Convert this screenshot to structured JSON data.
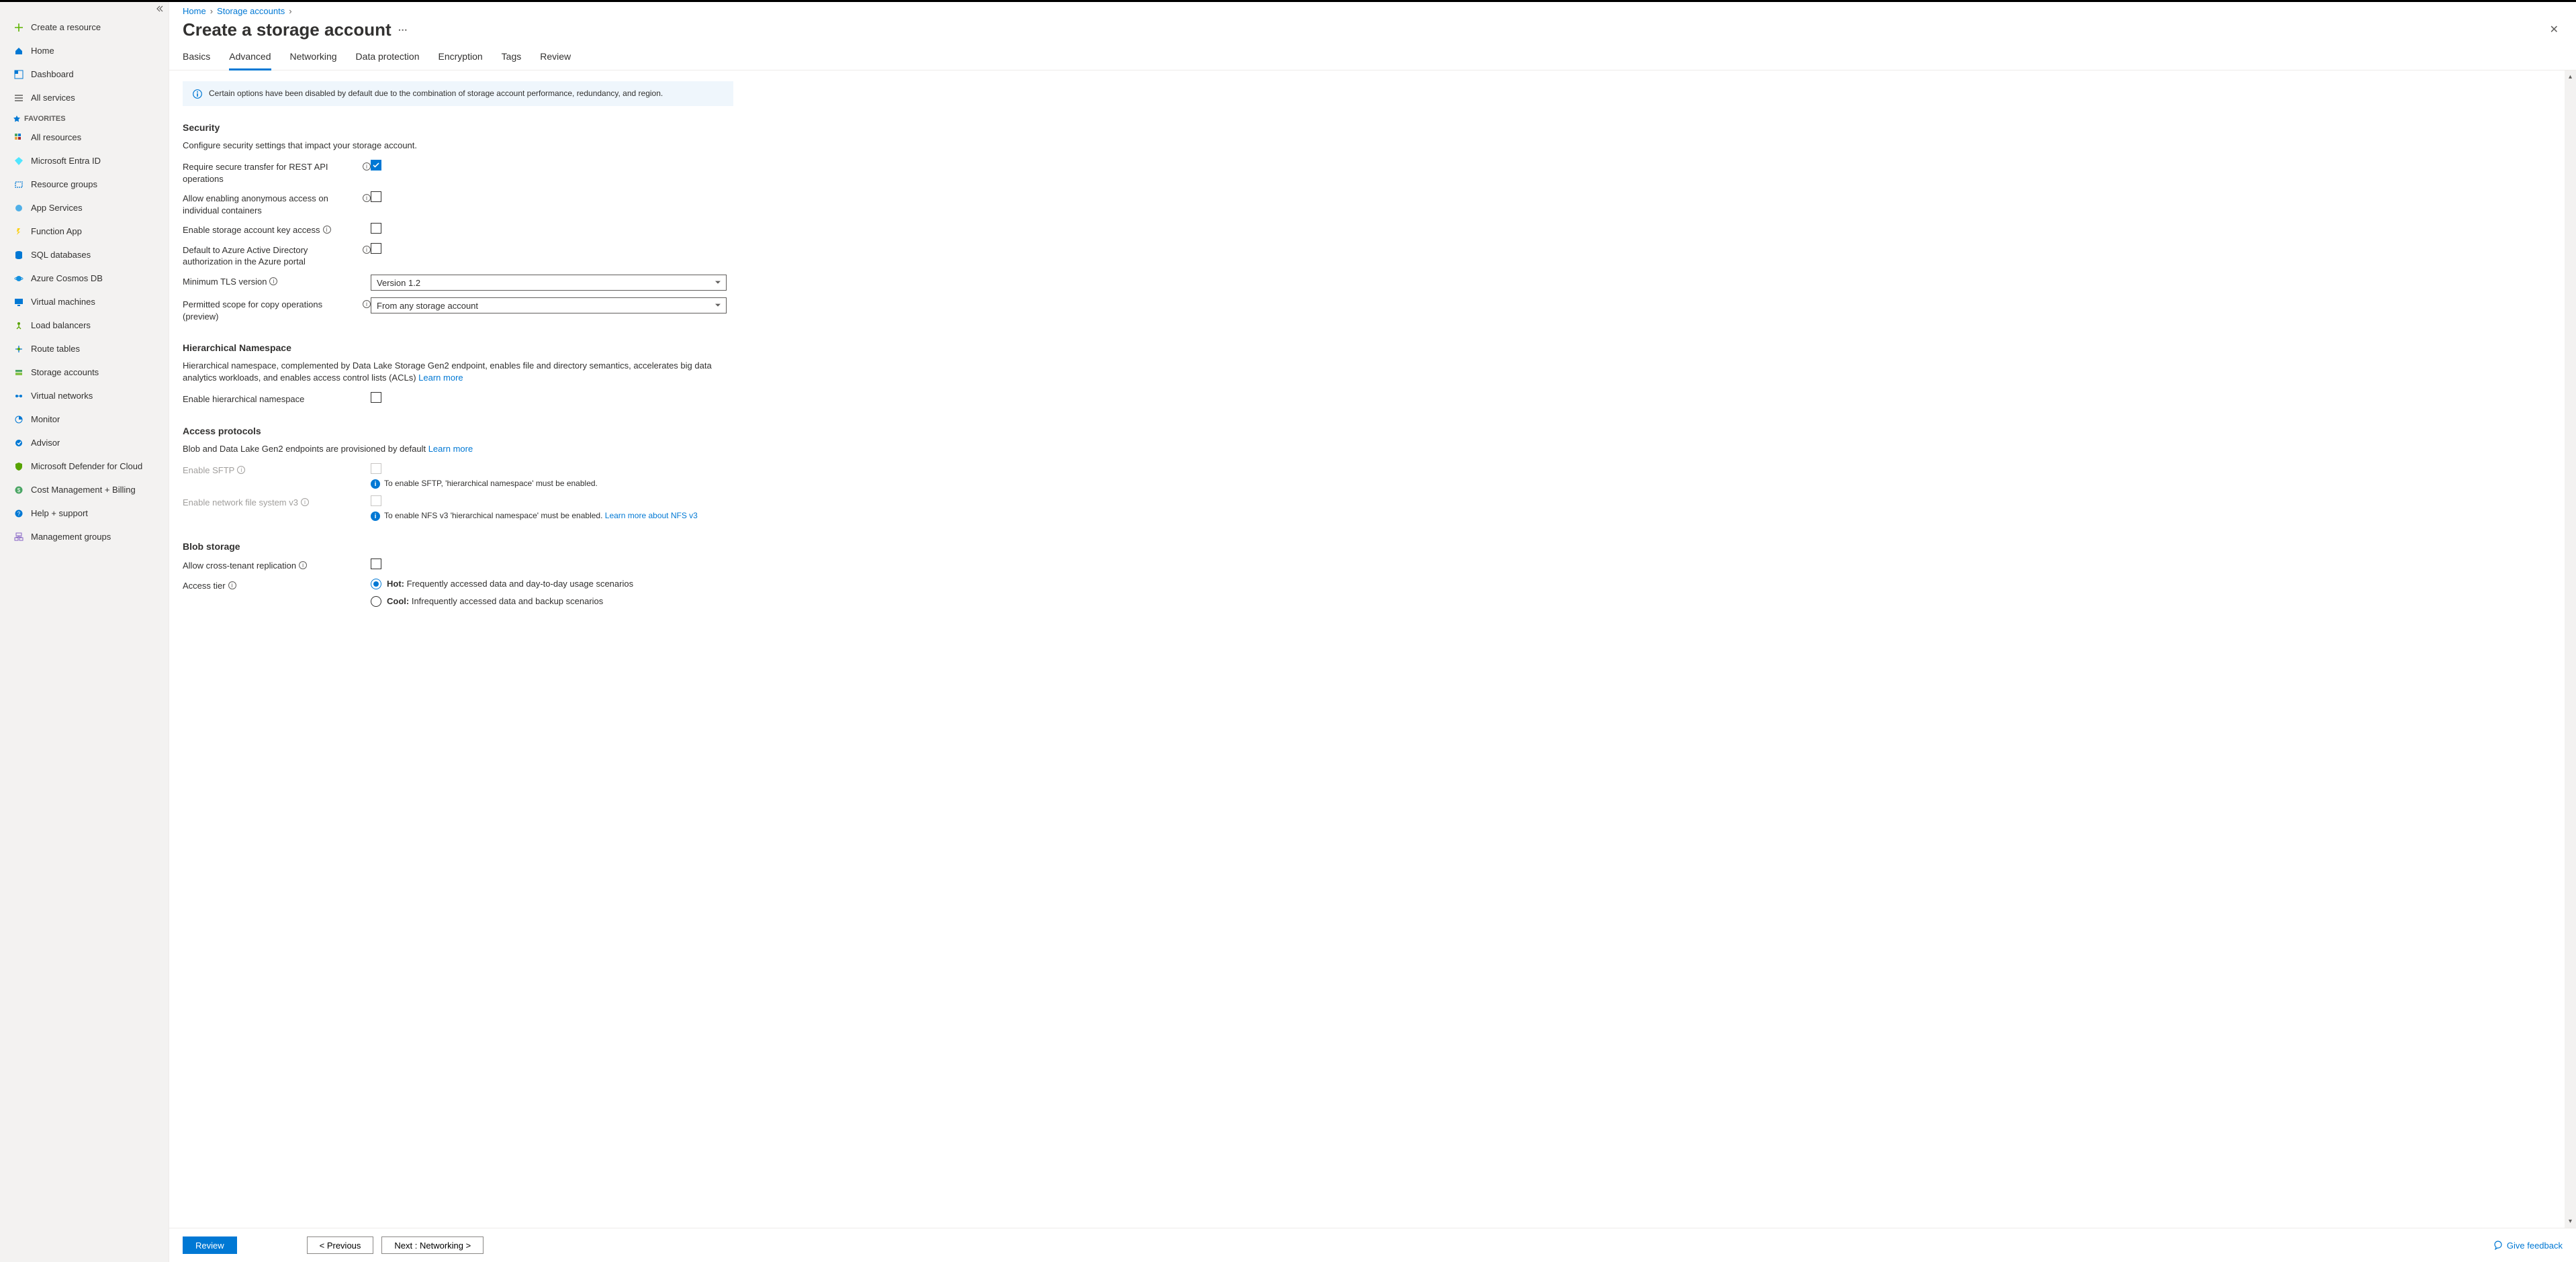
{
  "breadcrumb": {
    "home": "Home",
    "storage": "Storage accounts"
  },
  "page_title": "Create a storage account",
  "tabs": [
    "Basics",
    "Advanced",
    "Networking",
    "Data protection",
    "Encryption",
    "Tags",
    "Review"
  ],
  "active_tab_index": 1,
  "banner": "Certain options have been disabled by default due to the combination of storage account performance, redundancy, and region.",
  "sidebar": {
    "items": [
      "Create a resource",
      "Home",
      "Dashboard",
      "All services"
    ],
    "fav_header": "FAVORITES",
    "favorites": [
      "All resources",
      "Microsoft Entra ID",
      "Resource groups",
      "App Services",
      "Function App",
      "SQL databases",
      "Azure Cosmos DB",
      "Virtual machines",
      "Load balancers",
      "Route tables",
      "Storage accounts",
      "Virtual networks",
      "Monitor",
      "Advisor",
      "Microsoft Defender for Cloud",
      "Cost Management + Billing",
      "Help + support",
      "Management groups"
    ]
  },
  "security": {
    "heading": "Security",
    "desc": "Configure security settings that impact your storage account.",
    "rows": {
      "secure_transfer": "Require secure transfer for REST API operations",
      "anon_access": "Allow enabling anonymous access on individual containers",
      "key_access": "Enable storage account key access",
      "aad_default": "Default to Azure Active Directory authorization in the Azure portal",
      "min_tls": "Minimum TLS version",
      "copy_scope": "Permitted scope for copy operations (preview)"
    },
    "tls_value": "Version 1.2",
    "copy_value": "From any storage account"
  },
  "hns": {
    "heading": "Hierarchical Namespace",
    "desc": "Hierarchical namespace, complemented by Data Lake Storage Gen2 endpoint, enables file and directory semantics, accelerates big data analytics workloads, and enables access control lists (ACLs) ",
    "learn": "Learn more",
    "row": "Enable hierarchical namespace"
  },
  "access": {
    "heading": "Access protocols",
    "desc": "Blob and Data Lake Gen2 endpoints are provisioned by default ",
    "learn": "Learn more",
    "sftp_label": "Enable SFTP",
    "sftp_hint": "To enable SFTP, 'hierarchical namespace' must be enabled.",
    "nfs_label": "Enable network file system v3",
    "nfs_hint": "To enable NFS v3 'hierarchical namespace' must be enabled. ",
    "nfs_link": "Learn more about NFS v3"
  },
  "blob": {
    "heading": "Blob storage",
    "cross_tenant": "Allow cross-tenant replication",
    "tier_label": "Access tier",
    "hot_b": "Hot:",
    "hot_rest": " Frequently accessed data and day-to-day usage scenarios",
    "cool_b": "Cool:",
    "cool_rest": " Infrequently accessed data and backup scenarios"
  },
  "footer": {
    "review": "Review",
    "prev": "< Previous",
    "next": "Next : Networking >",
    "feedback": "Give feedback"
  }
}
